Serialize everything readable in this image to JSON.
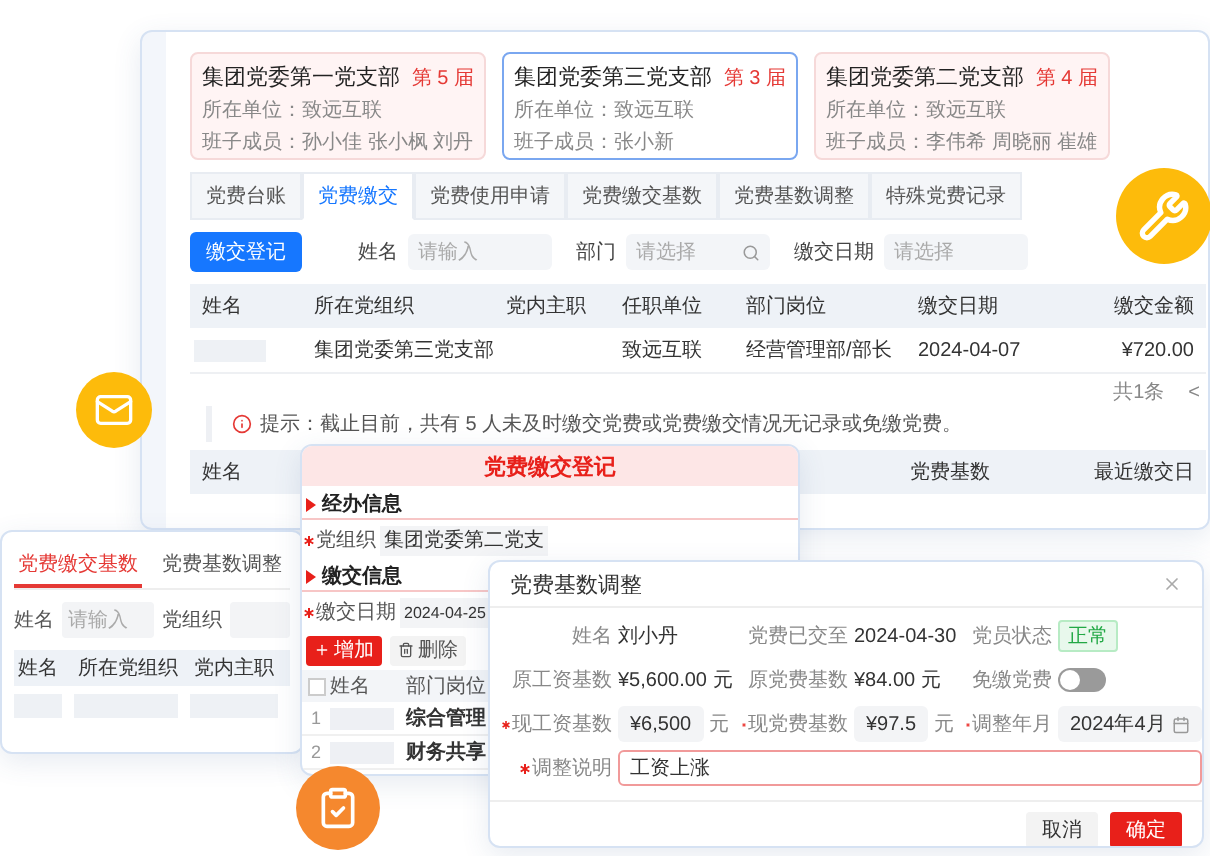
{
  "main_window": {
    "branches": [
      {
        "name": "集团党委第一党支部",
        "term": "第 5 届",
        "unit": "所在单位：致远互联",
        "members": "班子成员：孙小佳 张小枫 刘丹",
        "selected": false
      },
      {
        "name": "集团党委第三党支部",
        "term": "第 3 届",
        "unit": "所在单位：致远互联",
        "members": "班子成员：张小新",
        "selected": true
      },
      {
        "name": "集团党委第二党支部",
        "term": "第 4 届",
        "unit": "所在单位：致远互联",
        "members": "班子成员：李伟希 周晓丽 崔雄",
        "selected": false
      }
    ],
    "tabs": [
      {
        "label": "党费台账",
        "selected": false
      },
      {
        "label": "党费缴交",
        "selected": true
      },
      {
        "label": "党费使用申请",
        "selected": false
      },
      {
        "label": "党费缴交基数",
        "selected": false
      },
      {
        "label": "党费基数调整",
        "selected": false
      },
      {
        "label": "特殊党费记录",
        "selected": false
      }
    ],
    "toolbar": {
      "button": "缴交登记",
      "filters": [
        {
          "label": "姓名",
          "placeholder": "请输入",
          "kind": "text"
        },
        {
          "label": "部门",
          "placeholder": "请选择",
          "kind": "search"
        },
        {
          "label": "缴交日期",
          "placeholder": "请选择",
          "kind": "text"
        }
      ]
    },
    "table": {
      "columns": [
        "姓名",
        "所在党组织",
        "党内主职",
        "任职单位",
        "部门岗位",
        "缴交日期",
        "缴交金额"
      ],
      "rows": [
        {
          "organization": "集团党委第三党支部",
          "unit": "致远互联",
          "post": "经营管理部/部长",
          "date": "2024-04-07",
          "amount": "¥720.00"
        }
      ]
    },
    "pagination": {
      "total": "共1条",
      "prev": "<"
    },
    "notice": "提示：截止目前，共有 5 人未及时缴交党费或党费缴交情况无记录或免缴党费。",
    "second_table": {
      "columns": [
        "姓名",
        "党费基数",
        "最近缴交日"
      ]
    }
  },
  "base_panel": {
    "tabs": [
      {
        "label": "党费缴交基数",
        "selected": true
      },
      {
        "label": "党费基数调整",
        "selected": false
      }
    ],
    "filters": [
      {
        "label": "姓名",
        "placeholder": "请输入"
      },
      {
        "label": "党组织"
      }
    ],
    "columns": [
      "姓名",
      "所在党组织",
      "党内主职"
    ]
  },
  "registration_dialog": {
    "title": "党费缴交登记",
    "sections": [
      {
        "title": "经办信息",
        "fields": [
          {
            "label": "党组织",
            "required": true,
            "kind": "select",
            "value": "集团党委第二党支"
          }
        ]
      },
      {
        "title": "缴交信息",
        "fields": [
          {
            "label": "缴交日期",
            "required": true,
            "kind": "date",
            "value": "2024-04-25"
          }
        ]
      }
    ],
    "add_button": "增加",
    "delete_button": "删除",
    "select_all": {
      "checked": false
    },
    "columns": [
      "姓名",
      "部门岗位"
    ],
    "rows": [
      {
        "index": "1",
        "department": "综合管理"
      },
      {
        "index": "2",
        "department": "财务共享"
      }
    ]
  },
  "adjust_dialog": {
    "title": "党费基数调整",
    "fields": [
      {
        "kind": "text",
        "label": "姓名",
        "value": "刘小丹"
      },
      {
        "kind": "text",
        "label": "党费已交至",
        "value": "2024-04-30"
      },
      {
        "kind": "tag",
        "label": "党员状态",
        "value": "正常"
      },
      {
        "kind": "text",
        "label": "原工资基数",
        "value": "¥5,600.00 元"
      },
      {
        "kind": "text",
        "label": "原党费基数",
        "value": "¥84.00 元"
      },
      {
        "kind": "switch",
        "label": "免缴党费",
        "on": false
      },
      {
        "kind": "input",
        "label": "现工资基数",
        "required": true,
        "value": "¥6,500",
        "unit": "元"
      },
      {
        "kind": "input",
        "label": "现党费基数",
        "required": true,
        "value": "¥97.5",
        "unit": "元"
      },
      {
        "kind": "date",
        "label": "调整年月",
        "required": true,
        "value": "2024年4月"
      },
      {
        "kind": "textarea",
        "label": "调整说明",
        "required": true,
        "value": "工资上涨"
      }
    ],
    "buttons": [
      {
        "label": "取消",
        "primary": false
      },
      {
        "label": "确定",
        "primary": true
      }
    ]
  }
}
